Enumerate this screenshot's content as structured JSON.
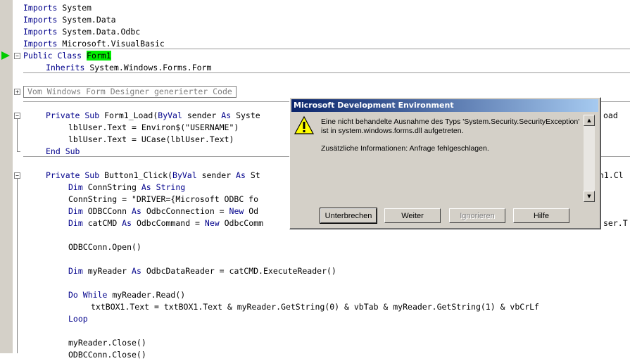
{
  "code": {
    "imports": [
      {
        "kw": "Imports",
        "text": " System"
      },
      {
        "kw": "Imports",
        "text": " System.Data"
      },
      {
        "kw": "Imports",
        "text": " System.Data.Odbc"
      },
      {
        "kw": "Imports",
        "text": " Microsoft.VisualBasic"
      }
    ],
    "class_kw": "Public Class",
    "class_name": "Form1",
    "inherits_kw": "Inherits",
    "inherits_text": " System.Windows.Forms.Form",
    "collapsed_region": "Vom Windows Form Designer generierter Code",
    "form_load_kw1": "Private Sub",
    "form_load_text1": " Form1_Load(",
    "form_load_kw2": "ByVal",
    "form_load_text2": " sender ",
    "form_load_kw3": "As",
    "form_load_text3": " Syste",
    "form_load_tail": "oad",
    "lbl1": "lblUser.Text = Environ$(\"USERNAME\")",
    "lbl2": "lblUser.Text = UCase(lblUser.Text)",
    "end_sub": "End Sub",
    "btn_kw1": "Private Sub",
    "btn_text1": " Button1_Click(",
    "btn_kw2": "ByVal",
    "btn_text2": " sender ",
    "btn_kw3": "As",
    "btn_text3": " St",
    "btn_tail": "on1.Cl",
    "dim_kw": "Dim",
    "conn_string_text": " ConnString ",
    "as_kw": "As",
    "string_kw": " String",
    "conn_assign": "ConnString = \"DRIVER={Microsoft ODBC fo",
    "odbc_conn_text": " ODBCConn ",
    "odbc_conn_type": " OdbcConnection = ",
    "new_kw": "New",
    "odbc_conn_tail": " Od",
    "cat_cmd_text": " catCMD ",
    "cat_cmd_type": " OdbcCommand = ",
    "cat_cmd_tail": " OdbcComm",
    "cat_cmd_right": "ser.T",
    "open_line": "ODBCConn.Open()",
    "reader_text": " myReader ",
    "reader_type": " OdbcDataReader = catCMD.ExecuteReader()",
    "do_while_kw": "Do While",
    "do_while_text": " myReader.Read()",
    "txtbox_line": "txtBOX1.Text = txtBOX1.Text & myReader.GetString(0) & vbTab & myReader.GetString(1) & vbCrLf",
    "loop_kw": "Loop",
    "close_line": "myReader.Close()",
    "last_line": "ODBCConn.Close()"
  },
  "dialog": {
    "title": "Microsoft Development Environment",
    "message": "Eine nicht behandelte Ausnahme des Typs 'System.Security.SecurityException' ist in system.windows.forms.dll aufgetreten.",
    "extra": "Zusätzliche Informationen: Anfrage fehlgeschlagen.",
    "buttons": {
      "break": "Unterbrechen",
      "continue": "Weiter",
      "ignore": "Ignorieren",
      "help": "Hilfe"
    }
  },
  "colors": {
    "keyword": "#00008b",
    "highlight": "#00ee00",
    "titlebar": "#0a246a"
  }
}
